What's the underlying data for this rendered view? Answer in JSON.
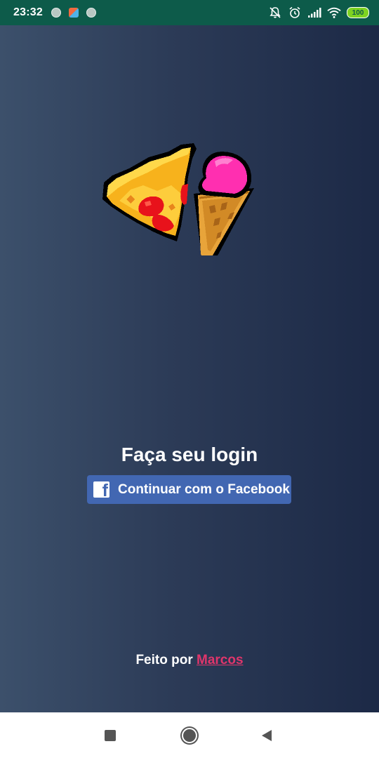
{
  "status_bar": {
    "time": "23:32",
    "battery_level": "100",
    "icons": [
      "notification-dot-icon",
      "app-notification-icon",
      "notification-dot-icon",
      "mute-icon",
      "alarm-icon",
      "signal-icon",
      "wifi-icon",
      "battery-icon"
    ],
    "background_color": "#0d5b4a"
  },
  "app": {
    "logo_icons": [
      "pizza-slice-icon",
      "ice-cream-cone-icon"
    ],
    "login_title": "Faça seu login",
    "facebook_button_label": "Continuar com o Facebook",
    "facebook_color": "#4267b2",
    "footer_prefix": "Feito por",
    "footer_author": "Marcos",
    "author_link_color": "#e0356b"
  },
  "nav_bar": {
    "icons": [
      "recents-icon",
      "home-icon",
      "back-icon"
    ]
  }
}
